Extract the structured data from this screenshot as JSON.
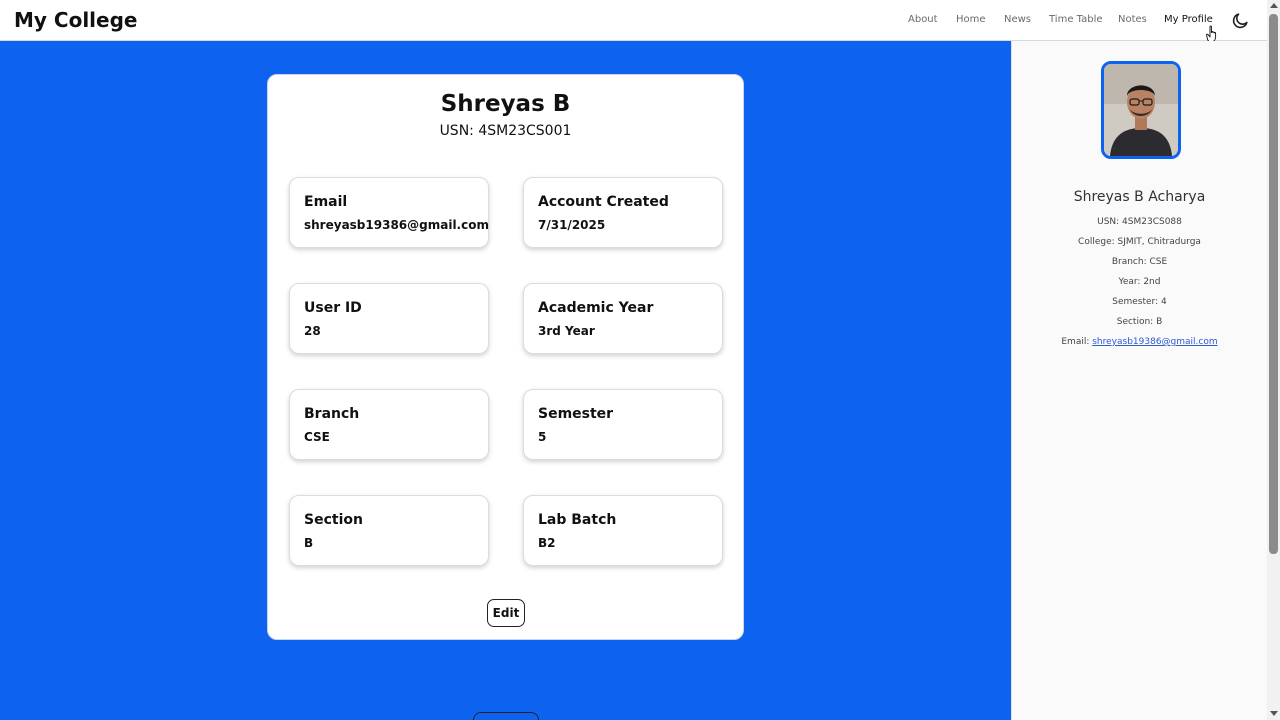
{
  "header": {
    "brand": "My College",
    "nav": [
      "About",
      "Home",
      "News",
      "Time Table",
      "Notes",
      "My Profile"
    ],
    "active_nav": "My Profile",
    "theme_icon": "moon-icon"
  },
  "profile_card": {
    "name": "Shreyas B",
    "usn": "USN: 4SM23CS001",
    "fields": [
      {
        "label": "Email",
        "value": "shreyasb19386@gmail.com"
      },
      {
        "label": "Account Created",
        "value": "7/31/2025"
      },
      {
        "label": "User ID",
        "value": "28"
      },
      {
        "label": "Academic Year",
        "value": "3rd Year"
      },
      {
        "label": "Branch",
        "value": "CSE"
      },
      {
        "label": "Semester",
        "value": "5"
      },
      {
        "label": "Section",
        "value": "B"
      },
      {
        "label": "Lab Batch",
        "value": "B2"
      }
    ],
    "edit_label": "Edit"
  },
  "sidebar": {
    "name": "Shreyas B Acharya",
    "usn": "USN: 4SM23CS088",
    "college": "College: SJMIT, Chitradurga",
    "branch": "Branch: CSE",
    "year": "Year: 2nd",
    "semester": "Semester: 4",
    "section": "Section: B",
    "email_label": "Email: ",
    "email": "shreyasb19386@gmail.com"
  },
  "colors": {
    "accent": "#0d63ef",
    "link": "#2d5bd0"
  }
}
